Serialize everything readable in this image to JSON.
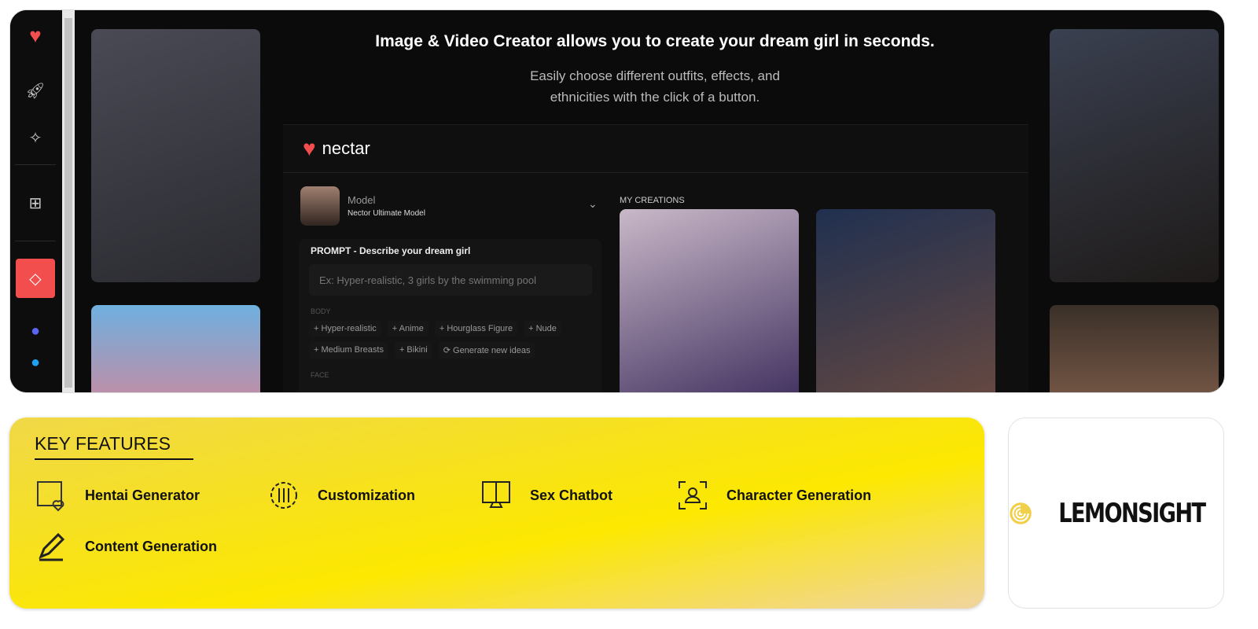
{
  "hero": {
    "title": "Image & Video Creator allows you to create your dream girl in seconds.",
    "subtitle": "Easily choose different outfits, effects, and ethnicities with the click of a button."
  },
  "app": {
    "brand": "nectar",
    "model_label": "Model",
    "model_value": "Nector Ultimate Model",
    "prompt_label": "PROMPT - Describe your dream girl",
    "prompt_placeholder": "Ex: Hyper-realistic, 3 girls by the swimming pool",
    "body_label": "BODY",
    "body_chips_row1": [
      "+ Hyper-realistic",
      "+ Anime",
      "+ Hourglass Figure",
      "+ Nude"
    ],
    "body_chips_row2": [
      "+ Medium Breasts",
      "+ Bikini",
      "⟳ Generate new ideas"
    ],
    "face_label": "FACE",
    "creations_label": "MY CREATIONS"
  },
  "features": {
    "title": "KEY FEATURES",
    "items": [
      {
        "label": "Hentai Generator",
        "icon": "gallery-heart-icon"
      },
      {
        "label": "Customization",
        "icon": "gear-sliders-icon"
      },
      {
        "label": "Sex Chatbot",
        "icon": "monitor-gender-icon"
      },
      {
        "label": "Character Generation",
        "icon": "user-frame-icon"
      },
      {
        "label": "Content Generation",
        "icon": "pencil-icon"
      }
    ]
  },
  "brand": {
    "name": "LEMONSIGHT"
  },
  "colors": {
    "accent": "#f24e4e",
    "yellow": "#fce800"
  }
}
